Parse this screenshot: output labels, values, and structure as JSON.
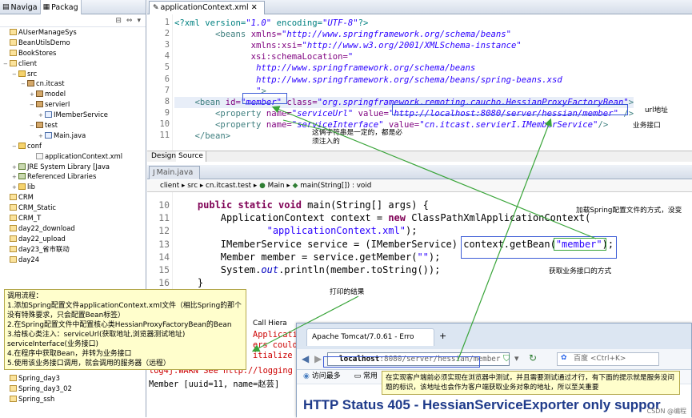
{
  "left_panel": {
    "tabs": [
      "Naviga",
      "Packag"
    ],
    "tree": [
      {
        "label": "AUserManageSys",
        "indent": 1,
        "icon": "proj",
        "twisty": ""
      },
      {
        "label": "BeanUtilsDemo",
        "indent": 1,
        "icon": "proj",
        "twisty": ""
      },
      {
        "label": "BookStores",
        "indent": 1,
        "icon": "proj",
        "twisty": ""
      },
      {
        "label": "client",
        "indent": 1,
        "icon": "proj",
        "twisty": "−"
      },
      {
        "label": "src",
        "indent": 2,
        "icon": "fold",
        "twisty": "−"
      },
      {
        "label": "cn.itcast",
        "indent": 3,
        "icon": "pkg",
        "twisty": "−"
      },
      {
        "label": "model",
        "indent": 4,
        "icon": "pkg",
        "twisty": "+"
      },
      {
        "label": "servierI",
        "indent": 4,
        "icon": "pkg",
        "twisty": "−"
      },
      {
        "label": "IMemberService",
        "indent": 5,
        "icon": "java",
        "twisty": "+"
      },
      {
        "label": "test",
        "indent": 4,
        "icon": "pkg",
        "twisty": "−"
      },
      {
        "label": "Main.java",
        "indent": 5,
        "icon": "java",
        "twisty": "+"
      },
      {
        "label": "conf",
        "indent": 2,
        "icon": "fold",
        "twisty": "−"
      },
      {
        "label": "applicationContext.xml",
        "indent": 4,
        "icon": "xml",
        "twisty": ""
      },
      {
        "label": "JRE System Library [Java",
        "indent": 2,
        "icon": "lib",
        "twisty": "+"
      },
      {
        "label": "Referenced Libraries",
        "indent": 2,
        "icon": "lib",
        "twisty": "+"
      },
      {
        "label": "lib",
        "indent": 2,
        "icon": "fold",
        "twisty": "+"
      },
      {
        "label": "CRM",
        "indent": 1,
        "icon": "proj",
        "twisty": ""
      },
      {
        "label": "CRM_Static",
        "indent": 1,
        "icon": "proj",
        "twisty": ""
      },
      {
        "label": "CRM_T",
        "indent": 1,
        "icon": "proj",
        "twisty": ""
      },
      {
        "label": "day22_download",
        "indent": 1,
        "icon": "proj",
        "twisty": ""
      },
      {
        "label": "day22_upload",
        "indent": 1,
        "icon": "proj",
        "twisty": ""
      },
      {
        "label": "day23_省市联动",
        "indent": 1,
        "icon": "proj",
        "twisty": ""
      },
      {
        "label": "day24",
        "indent": 1,
        "icon": "proj",
        "twisty": ""
      }
    ],
    "tree_bottom": [
      "Spring_day3",
      "Spring_day3_02",
      "Spring_ssh"
    ]
  },
  "xml_editor": {
    "tab_label": "applicationContext.xml",
    "lines": [
      {
        "n": "1",
        "html": "<span class='t-pi'>&lt;?xml version=</span><span class='t-val'>\"1.0\"</span><span class='t-pi'> encoding=</span><span class='t-val'>\"UTF-8\"</span><span class='t-pi'>?&gt;</span>"
      },
      {
        "n": "2",
        "html": "        <span class='t-tag'>&lt;beans</span> <span class='t-attr'>xmlns=</span><span class='t-val'>\"http://www.springframework.org/schema/beans\"</span>"
      },
      {
        "n": "3",
        "html": "               <span class='t-attr'>xmlns:xsi=</span><span class='t-val'>\"http://www.w3.org/2001/XMLSchema-instance\"</span>"
      },
      {
        "n": "4",
        "html": "               <span class='t-attr'>xsi:schemaLocation=</span><span class='t-val'>\"</span>"
      },
      {
        "n": "5",
        "html": "                <span class='t-val'>http://www.springframework.org/schema/beans</span>"
      },
      {
        "n": "6",
        "html": "                <span class='t-val'>http://www.springframework.org/schema/beans/spring-beans.xsd</span>"
      },
      {
        "n": "7",
        "html": "                <span class='t-val'>\"</span><span class='t-tag'>&gt;</span>"
      },
      {
        "n": "8",
        "html": "    <span class='t-tag'>&lt;bean</span> <span class='t-attr'>id=</span><span class='t-val'>\"member\"</span> <span class='t-attr'>class=</span><span class='t-val'>\"org.springframework.remoting.caucho.HessianProxyFactoryBean\"</span><span class='t-tag'>&gt;</span>"
      },
      {
        "n": "9",
        "html": "        <span class='t-tag'>&lt;property</span> <span class='t-attr'>name=</span><span class='t-val'>\"serviceUrl\"</span> <span class='t-attr'>value=</span><span class='t-val'>\"http://localhost:8080/server/hessian/member\"</span> <span class='t-tag'>/&gt;</span>"
      },
      {
        "n": "10",
        "html": "        <span class='t-tag'>&lt;property</span> <span class='t-attr'>name=</span><span class='t-val'>\"serviceInterface\"</span> <span class='t-attr'>value=</span><span class='t-val'>\"cn.itcast.servierI.IMemberService\"</span><span class='t-tag'>/&gt;</span>"
      },
      {
        "n": "11",
        "html": "    <span class='t-tag'>&lt;/bean&gt;</span>"
      }
    ],
    "bottom_tabs": [
      "Design",
      "Source"
    ]
  },
  "java_editor": {
    "tab_label": "Main.java",
    "breadcrumb": [
      "client",
      "src",
      "cn.itcast.test",
      "Main",
      "main(String[]) : void"
    ],
    "lines": [
      {
        "n": "10",
        "html": "    <span class='kw'>public static void</span> main(String[] args) {"
      },
      {
        "n": "11",
        "html": "        ApplicationContext context = <span class='kw'>new</span> ClassPathXmlApplicationContext("
      },
      {
        "n": "12",
        "html": "                <span class='str'>\"applicationContext.xml\"</span>);"
      },
      {
        "n": "13",
        "html": "        IMemberService service = (IMemberService) context.getBean(<span class='str'>\"member\"</span>);"
      },
      {
        "n": "14",
        "html": "        Member member = service.getMember(<span class='str'>\"\"</span>);"
      },
      {
        "n": "15",
        "html": "        System.<span class='fld'>out</span>.println(member.toString());"
      },
      {
        "n": "16",
        "html": "    }"
      }
    ]
  },
  "console": {
    "tab_label": "Call Hiera",
    "lines": [
      "Application",
      "ers could",
      "itialize",
      "log4j:WARN See http://logging",
      "Member [uuid=11, name=赵芸]"
    ]
  },
  "browser": {
    "tab_title": "Apache Tomcat/7.0.61 - Erro",
    "url_host": "localhost",
    "url_path": ":8080/server/hessian/member",
    "search_engine": "百度",
    "search_hint": "<Ctrl+K>",
    "bookmarks": [
      "访问最多",
      "常用"
    ],
    "status_heading": "HTTP Status 405 - HessianServiceExporter only suppor",
    "watermark": "CSDN @编程"
  },
  "annotations": {
    "steps_title": "调用流程：",
    "steps": [
      "1.添加Spring配置文件applicationContext.xml文件（相比Spring的那个没有特殊要求，只会配置Bean标签）",
      "2.在Spring配置文件中配置核心类HessianProxyFactoryBean的Bean",
      "3.给核心类注入：serviceUrl(获取地址,浏览器测试地址)",
      "serviceInterface(业务接口)",
      "4.在程序中获取Bean，并转为业务接口",
      "5.使用该业务接口调用，就会调用的服务器（远程）"
    ],
    "xml_id_note": "这俩字符串是一定的，都是必须注入的",
    "url_note": "url地址",
    "service_note": "业务接口",
    "spring_note": "加载Spring配置文件的方式，没变",
    "getbean_note": "获取业务接口的方式",
    "print_note": "打印的结果",
    "browser_note": "在实现客户端前必须实现在浏览器中测试，并且需要测试通过才行，有下面的提示就是服务没问题的标识，该地址也会作为客户端获取业务对象的地址，所以至关重要"
  },
  "colors": {
    "arrow": "#3aa53a",
    "box": "#3b5bd6",
    "note_bg": "#fffecc"
  }
}
